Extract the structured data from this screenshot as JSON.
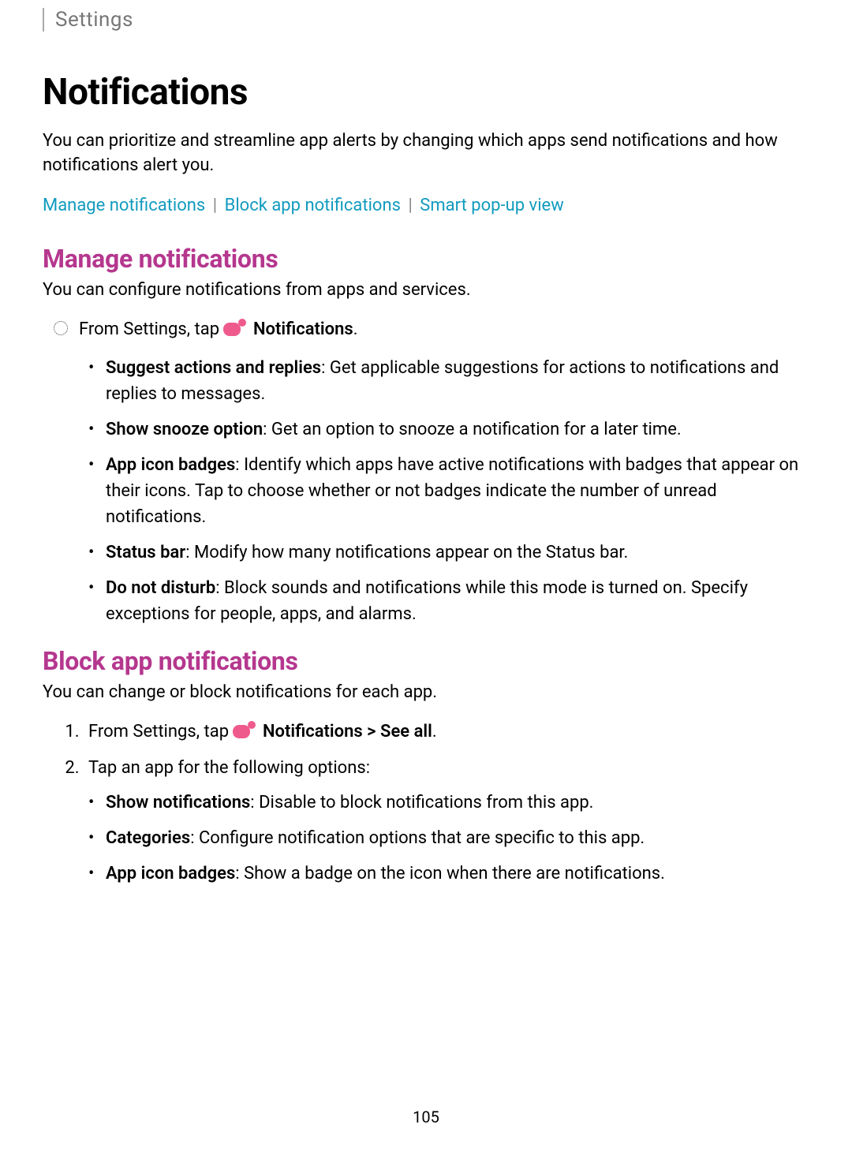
{
  "breadcrumb": "Settings",
  "pageTitle": "Notifications",
  "intro": "You can prioritize and streamline app alerts by changing which apps send notifications and how notifications alert you.",
  "links": {
    "manage": "Manage notifications",
    "block": "Block app notifications",
    "smart": "Smart pop-up view"
  },
  "section1": {
    "title": "Manage notifications",
    "intro": "You can configure notifications from apps and services.",
    "lead_prefix": "From Settings, tap ",
    "lead_bold": "Notifications",
    "lead_suffix": ".",
    "items": [
      {
        "term": "Suggest actions and replies",
        "desc": ": Get applicable suggestions for actions to notifications and replies to messages."
      },
      {
        "term": "Show snooze option",
        "desc": ": Get an option to snooze a notification for a later time."
      },
      {
        "term": "App icon badges",
        "desc": ": Identify which apps have active notifications with badges that appear on their icons. Tap to choose whether or not badges indicate the number of unread notifications."
      },
      {
        "term": "Status bar",
        "desc": ": Modify how many notifications appear on the Status bar."
      },
      {
        "term": "Do not disturb",
        "desc": ": Block sounds and notifications while this mode is turned on. Specify exceptions for people, apps, and alarms."
      }
    ]
  },
  "section2": {
    "title": "Block app notifications",
    "intro": "You can change or block notifications for each app.",
    "step1_prefix": "From Settings, tap ",
    "step1_bold": "Notifications > See all",
    "step1_suffix": ".",
    "step2": "Tap an app for the following options:",
    "items": [
      {
        "term": "Show notifications",
        "desc": ": Disable to block notifications from this app."
      },
      {
        "term": "Categories",
        "desc": ": Configure notification options that are specific to this app."
      },
      {
        "term": "App icon badges",
        "desc": ": Show a badge on the icon when there are notifications."
      }
    ]
  },
  "pageNumber": "105"
}
